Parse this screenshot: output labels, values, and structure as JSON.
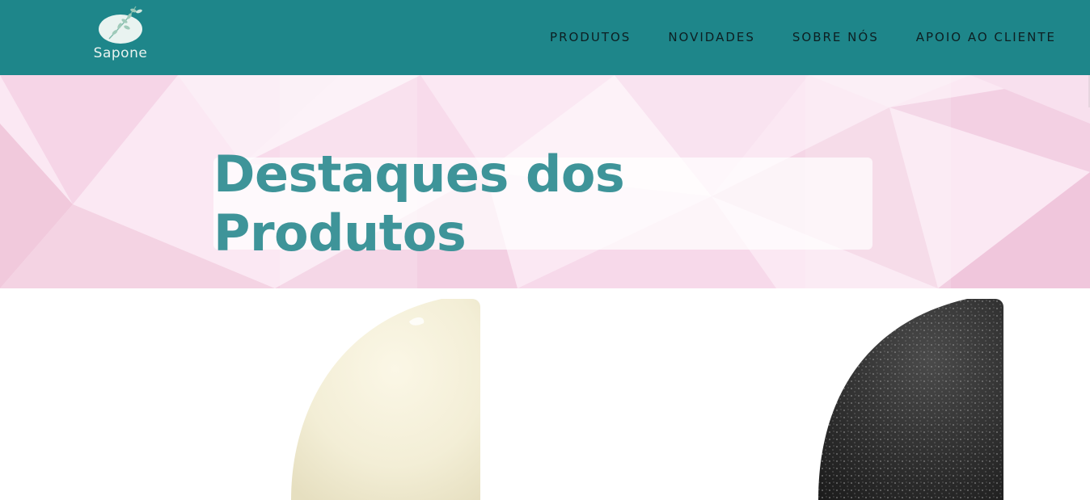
{
  "brand": {
    "name": "Sapone",
    "header_color": "#1e868a",
    "accent_color": "#3e9499"
  },
  "nav": {
    "items": [
      {
        "label": "PRODUTOS"
      },
      {
        "label": "NOVIDADES"
      },
      {
        "label": "SOBRE NÓS"
      },
      {
        "label": "APOIO AO CLIENTE"
      }
    ]
  },
  "hero": {
    "title": "Destaques dos Produtos"
  },
  "products": [
    {
      "image_icon": "cream-soap-bar-image",
      "color": "#f4efd9"
    },
    {
      "image_icon": "charcoal-soap-bar-image",
      "color": "#2b2b2b"
    }
  ]
}
